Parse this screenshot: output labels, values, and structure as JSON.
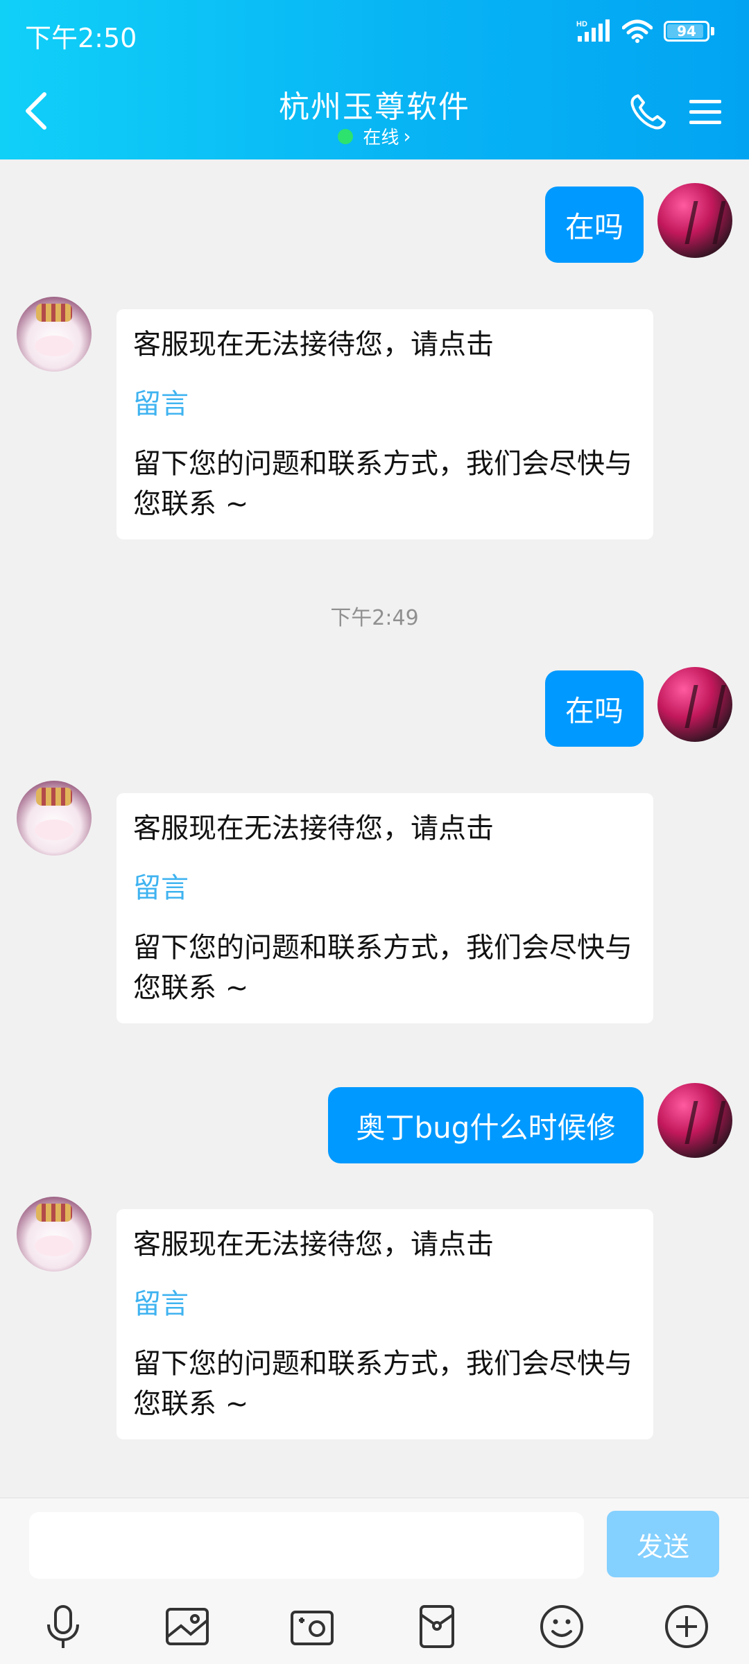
{
  "status_bar": {
    "time": "下午2:50",
    "battery": "94",
    "battery_level_percent": 94
  },
  "header": {
    "title": "杭州玉尊软件",
    "presence": "在线",
    "presence_chevron": "›"
  },
  "messages": [
    {
      "type": "outgoing",
      "text": "在吗"
    },
    {
      "type": "incoming",
      "line1": "客服现在无法接待您，请点击",
      "link": "留言",
      "line2": "留下您的问题和联系方式，我们会尽快与您联系 ~"
    },
    {
      "type": "timestamp",
      "text": "下午2:49"
    },
    {
      "type": "outgoing",
      "text": "在吗"
    },
    {
      "type": "incoming",
      "line1": "客服现在无法接待您，请点击",
      "link": "留言",
      "line2": "留下您的问题和联系方式，我们会尽快与您联系 ~"
    },
    {
      "type": "outgoing",
      "text": "奥丁bug什么时候修"
    },
    {
      "type": "incoming",
      "line1": "客服现在无法接待您，请点击",
      "link": "留言",
      "line2": "留下您的问题和联系方式，我们会尽快与您联系 ~"
    }
  ],
  "composer": {
    "input_value": "",
    "send_label": "发送"
  },
  "toolbar_icons": [
    "microphone-icon",
    "image-icon",
    "camera-icon",
    "red-packet-icon",
    "emoji-icon",
    "plus-icon"
  ],
  "colors": {
    "header_start": "#10d0f8",
    "header_end": "#02a4f2",
    "outgoing_bubble": "#0099ff",
    "link": "#3fb3f0",
    "send_disabled": "#84d0ff",
    "online_dot": "#2ee26e"
  }
}
